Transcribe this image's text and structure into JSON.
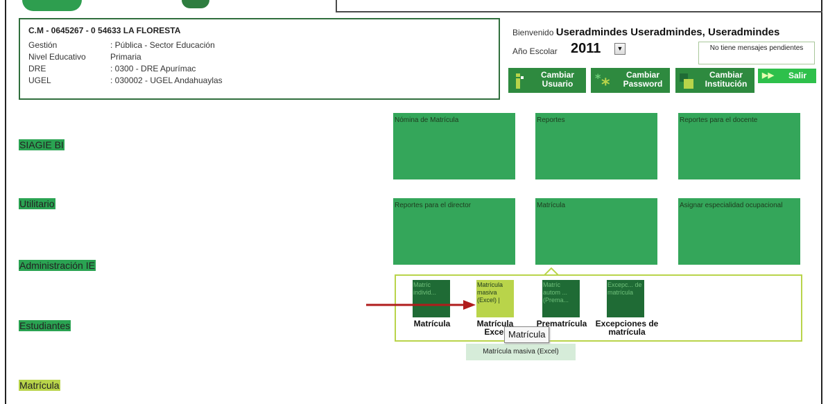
{
  "institution": {
    "title": "C.M - 0645267 - 0 54633 LA FLORESTA",
    "rows": [
      {
        "label": "Gestión",
        "value": ": Pública - Sector Educación"
      },
      {
        "label": "Nivel Educativo",
        "value": "Primaria"
      },
      {
        "label": "DRE",
        "value": ": 0300 - DRE Apurímac"
      },
      {
        "label": "UGEL",
        "value": ": 030002 - UGEL Andahuaylas"
      }
    ]
  },
  "header": {
    "welcome_prefix": "Bienvenido",
    "user_name": "Useradmindes Useradmindes, Useradmindes",
    "year_label": "Año Escolar",
    "year_value": "2011",
    "messages": "No tiene mensajes pendientes",
    "buttons": {
      "cambiar_usuario": [
        "Cambiar",
        "Usuario"
      ],
      "cambiar_password": [
        "Cambiar",
        "Password"
      ],
      "cambiar_institucion": [
        "Cambiar",
        "Institución"
      ],
      "salir": "Salir"
    }
  },
  "menu": [
    {
      "label": "SIAGIE BI"
    },
    {
      "label": "Utilitario"
    },
    {
      "label": "Administración IE"
    },
    {
      "label": "Estudiantes"
    },
    {
      "label": "Matrícula"
    }
  ],
  "tiles": [
    {
      "label": "Nómina de Matrícula"
    },
    {
      "label": "Reportes"
    },
    {
      "label": "Reportes para el docente"
    },
    {
      "label": "Reportes para el director"
    },
    {
      "label": "Matrícula"
    },
    {
      "label": "Asignar especialidad ocupacional"
    }
  ],
  "submenu": [
    {
      "tile_text": "Matríc individ...",
      "label": "Matrícula"
    },
    {
      "tile_text": "Matrícula masiva (Excel) |",
      "label": "Matrícula Excel"
    },
    {
      "tile_text": "Matríc autom ... (Prema...",
      "label": "Prematrícula"
    },
    {
      "tile_text": "Excepc... de matrícula",
      "label": "Excepciones de matrícula"
    }
  ],
  "tooltips": {
    "primary": "Matrícula",
    "secondary": "Matrícula masiva (Excel)"
  },
  "colors": {
    "tile_green": "#34a65a",
    "dark_green": "#1f6b35",
    "lime": "#b9d44a",
    "arrow_red": "#b01c1c"
  }
}
